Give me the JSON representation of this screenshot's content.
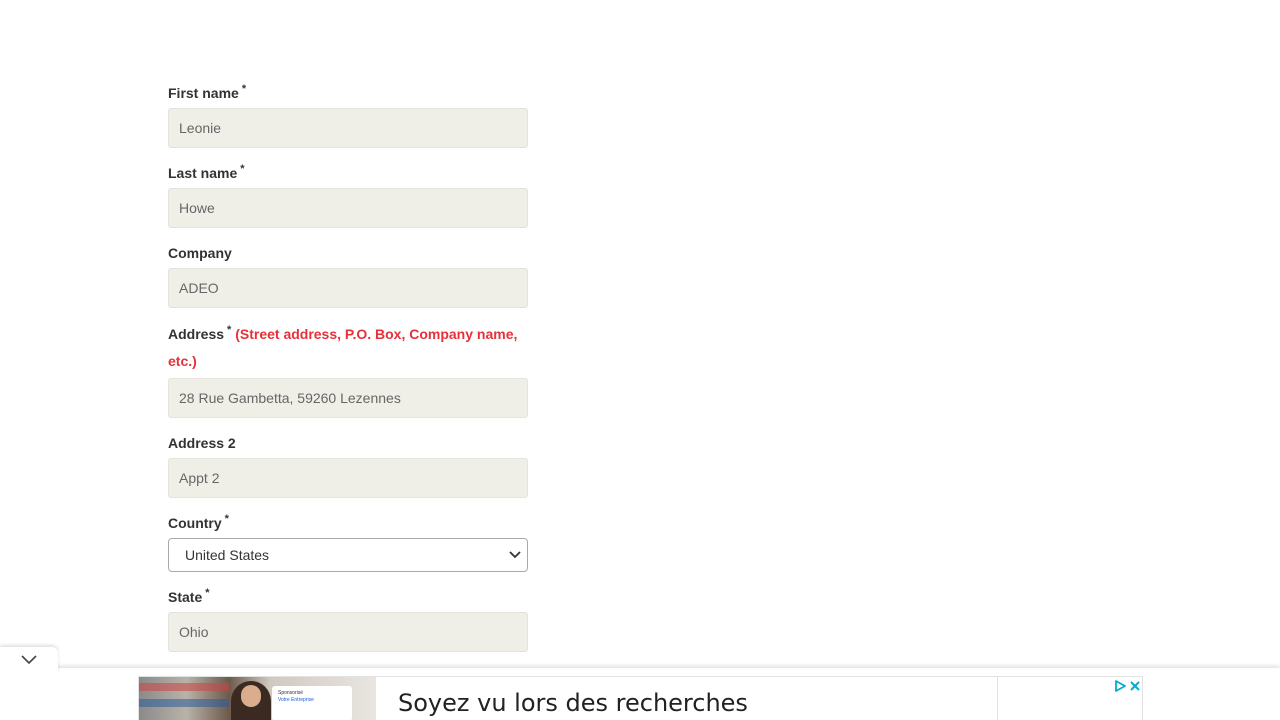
{
  "form": {
    "first_name": {
      "label": "First name",
      "required_mark": "*",
      "value": "Leonie"
    },
    "last_name": {
      "label": "Last name",
      "required_mark": "*",
      "value": "Howe"
    },
    "company": {
      "label": "Company",
      "value": "ADEO"
    },
    "address": {
      "label": "Address",
      "required_mark": "*",
      "hint": "(Street address, P.O. Box, Company name, etc.)",
      "value": "28 Rue Gambetta, 59260 Lezennes"
    },
    "address2": {
      "label": "Address 2",
      "value": "Appt 2"
    },
    "country": {
      "label": "Country",
      "required_mark": "*",
      "selected": "United States"
    },
    "state": {
      "label": "State",
      "required_mark": "*",
      "value": "Ohio"
    }
  },
  "ad": {
    "headline": "Soyez vu lors des recherches",
    "card_line1": "Sponsorisé",
    "card_line2": "Votre Entreprise"
  },
  "colors": {
    "field_bg": "#efefe8",
    "hint_red": "#e8303a",
    "label": "#333333"
  }
}
